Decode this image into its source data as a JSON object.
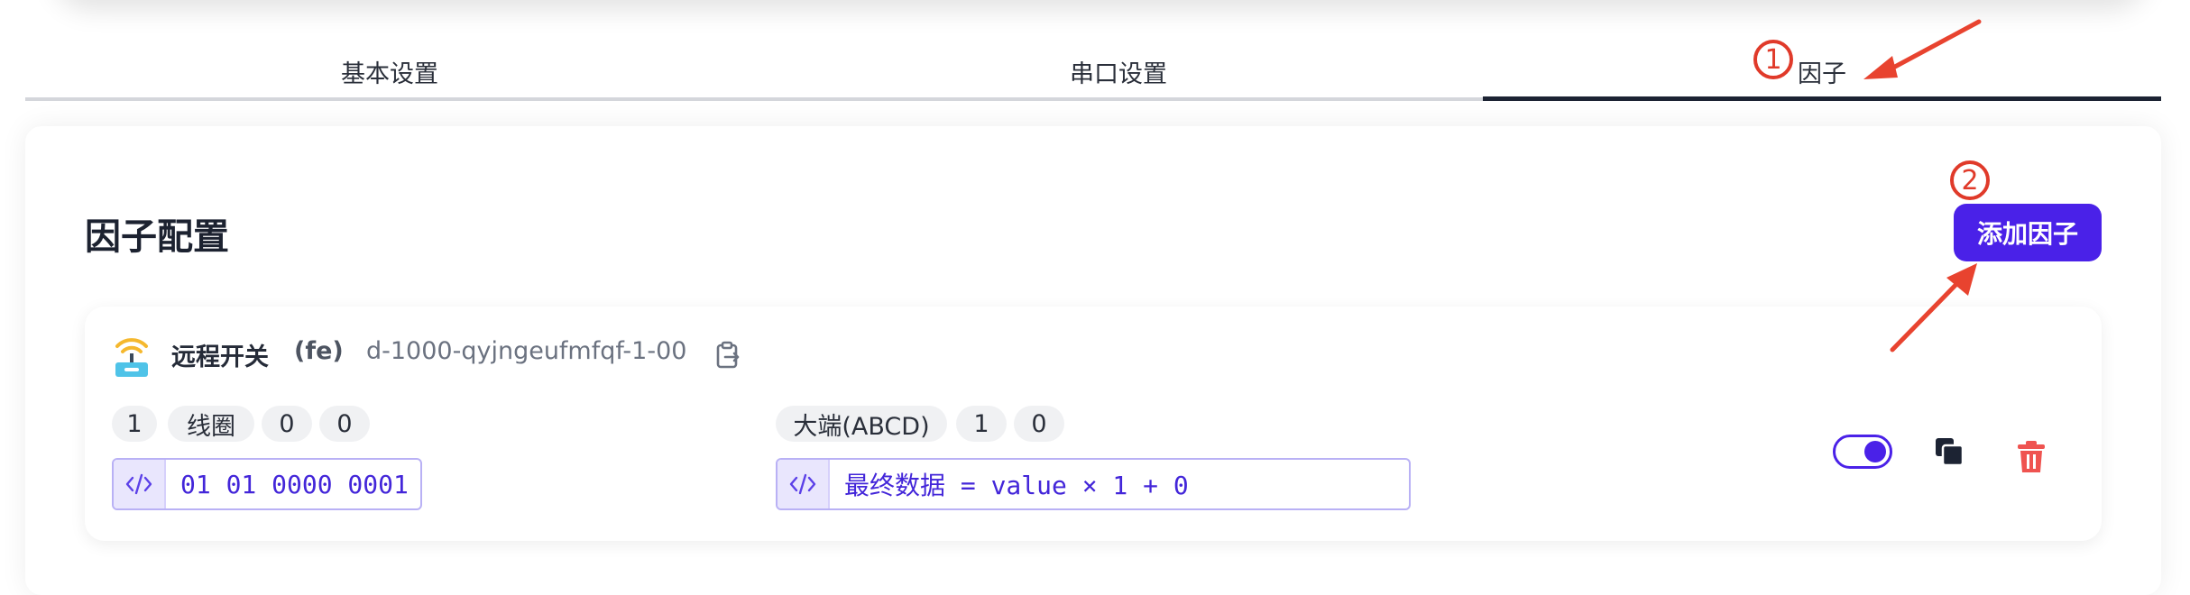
{
  "tabs": [
    {
      "label": "基本设置",
      "active": false
    },
    {
      "label": "串口设置",
      "active": false
    },
    {
      "label": "因子",
      "active": true
    }
  ],
  "annotations": {
    "step1": "1",
    "step2": "2",
    "color": "#e03a2a"
  },
  "section": {
    "title": "因子配置",
    "add_button": "添加因子"
  },
  "factor": {
    "name": "远程开关",
    "code": "(fe)",
    "id": "d-1000-qyjngeufmfqf-1-00",
    "icon": "wifi-router-icon",
    "left_pills": [
      "1",
      "线圈",
      "0",
      "0"
    ],
    "left_code": "01 01 0000 0001",
    "right_pills": [
      "大端(ABCD)",
      "1",
      "0"
    ],
    "right_code": "最终数据 = value × 1 + 0",
    "enabled": true
  },
  "colors": {
    "accent": "#4a21e8",
    "danger": "#ef5350",
    "icon_yellow": "#f5b82e",
    "icon_teal": "#4fc3e8"
  }
}
